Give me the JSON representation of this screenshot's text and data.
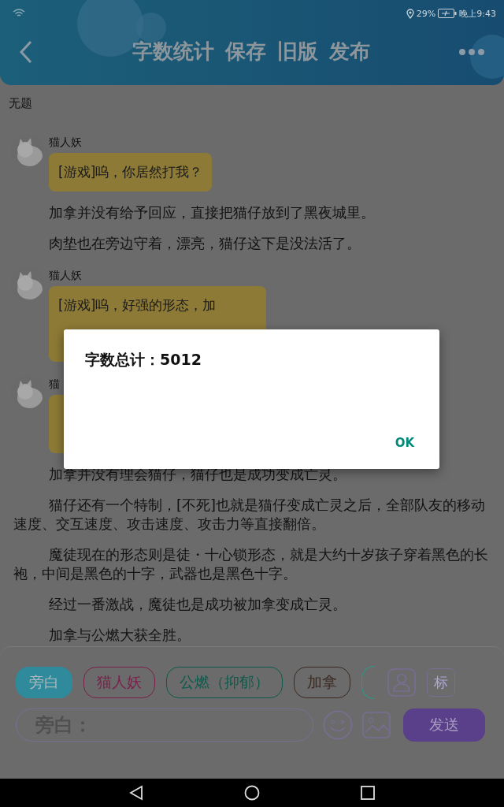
{
  "status_bar": {
    "battery": "29%",
    "time": "晚上9:43"
  },
  "header": {
    "actions": [
      "字数统计",
      "保存",
      "旧版",
      "发布"
    ]
  },
  "title": "无题",
  "messages": [
    {
      "kind": "dialogue",
      "speaker": "猫人妖",
      "text": "[游戏]呜，你居然打我？"
    },
    {
      "kind": "narration",
      "text": "加拿并没有给予回应，直接把猫仔放到了黑夜城里。"
    },
    {
      "kind": "narration",
      "text": "肉垫也在旁边守着，漂亮，猫仔这下是没法活了。"
    },
    {
      "kind": "dialogue",
      "speaker": "猫人妖",
      "text": "[游戏]呜，好强的形态，加"
    },
    {
      "kind": "dialogue",
      "speaker": "猫"
    },
    {
      "kind": "narration",
      "text": "加拿并没有理会猫仔，猫仔也是成功变成亡灵。"
    },
    {
      "kind": "narration",
      "text": "猫仔还有一个特制，[不死]也就是猫仔变成亡灵之后，全部队友的移动速度、交互速度、攻击速度、攻击力等直接翻倍。"
    },
    {
      "kind": "narration",
      "text": "魔徒现在的形态则是徒・十心锁形态，就是大约十岁孩子穿着黑色的长袍，中间是黑色的十字，武器也是黑色十字。"
    },
    {
      "kind": "narration",
      "text": "经过一番激战，魔徒也是成功被加拿变成亡灵。"
    },
    {
      "kind": "narration",
      "text": "加拿与公燃大获全胜。"
    }
  ],
  "characters": [
    {
      "label": "旁白",
      "color": "#2f8a9c",
      "selected": true
    },
    {
      "label": "猫人妖",
      "color": "#7a1f4a",
      "selected": false
    },
    {
      "label": "公燃（抑郁）",
      "color": "#0d5a4c",
      "selected": false
    },
    {
      "label": "加拿",
      "color": "#3a2a22",
      "selected": false
    }
  ],
  "tag_button": "标",
  "input": {
    "placeholder": "旁白："
  },
  "send_button": "发送",
  "dialog": {
    "message": "字数总计：5012",
    "ok": "OK"
  }
}
